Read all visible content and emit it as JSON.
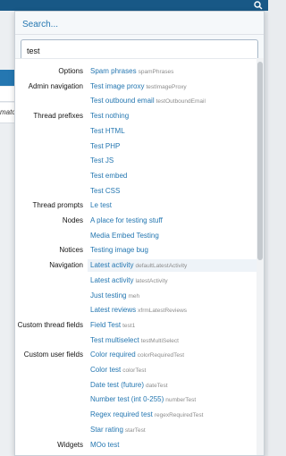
{
  "background": {
    "fragment_text": "mato"
  },
  "search": {
    "panel_title": "Search...",
    "query": "test"
  },
  "results": [
    {
      "category": "Options",
      "label": "Spam phrases",
      "sub": "spamPhrases"
    },
    {
      "category": "Admin navigation",
      "label": "Test image proxy",
      "sub": "testImageProxy"
    },
    {
      "category": "",
      "label": "Test outbound email",
      "sub": "testOutboundEmail"
    },
    {
      "category": "Thread prefixes",
      "label": "Test nothing",
      "sub": ""
    },
    {
      "category": "",
      "label": "Test HTML",
      "sub": ""
    },
    {
      "category": "",
      "label": "Test PHP",
      "sub": ""
    },
    {
      "category": "",
      "label": "Test JS",
      "sub": ""
    },
    {
      "category": "",
      "label": "Test embed",
      "sub": ""
    },
    {
      "category": "",
      "label": "Test CSS",
      "sub": ""
    },
    {
      "category": "Thread prompts",
      "label": "Le test",
      "sub": ""
    },
    {
      "category": "Nodes",
      "label": "A place for testing stuff",
      "sub": ""
    },
    {
      "category": "",
      "label": "Media Embed Testing",
      "sub": ""
    },
    {
      "category": "Notices",
      "label": "Testing image bug",
      "sub": ""
    },
    {
      "category": "Navigation",
      "label": "Latest activity",
      "sub": "defaultLatestActivity",
      "highlight": true
    },
    {
      "category": "",
      "label": "Latest activity",
      "sub": "latestActivity"
    },
    {
      "category": "",
      "label": "Just testing",
      "sub": "meh"
    },
    {
      "category": "",
      "label": "Latest reviews",
      "sub": "xfrmLatestReviews"
    },
    {
      "category": "Custom thread fields",
      "label": "Field Test",
      "sub": "test1"
    },
    {
      "category": "",
      "label": "Test multiselect",
      "sub": "testMultiSelect"
    },
    {
      "category": "Custom user fields",
      "label": "Color required",
      "sub": "colorRequiredTest"
    },
    {
      "category": "",
      "label": "Color test",
      "sub": "colorTest"
    },
    {
      "category": "",
      "label": "Date test (future)",
      "sub": "dateTest"
    },
    {
      "category": "",
      "label": "Number test (int 0-255)",
      "sub": "numberTest"
    },
    {
      "category": "",
      "label": "Regex required test",
      "sub": "regexRequiredTest"
    },
    {
      "category": "",
      "label": "Star rating",
      "sub": "starTest"
    },
    {
      "category": "Widgets",
      "label": "MOo test",
      "sub": ""
    }
  ],
  "colors": {
    "link": "#2577b1",
    "topbar": "#185886",
    "highlight_row": "#eef3f8"
  }
}
